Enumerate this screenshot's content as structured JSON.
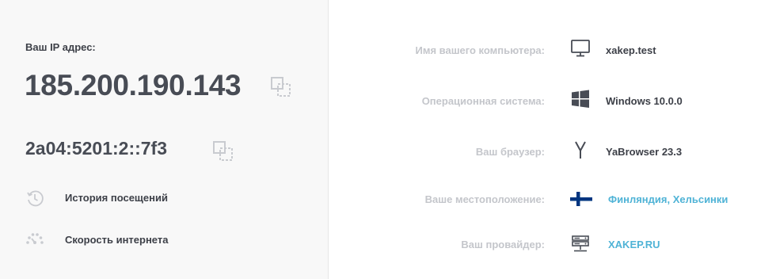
{
  "ip_block": {
    "label": "Ваш IP адрес:",
    "ipv4": "185.200.190.143",
    "ipv6": "2a04:5201:2::7f3"
  },
  "links": {
    "history": "История посещений",
    "speed": "Скорость интернета"
  },
  "info": [
    {
      "label": "Имя вашего компьютера:",
      "value": "xakep.test",
      "icon": "monitor-icon"
    },
    {
      "label": "Операционная система:",
      "value": "Windows 10.0.0",
      "icon": "windows-icon"
    },
    {
      "label": "Ваш браузер:",
      "value": "YaBrowser 23.3",
      "icon": "yandex-browser-icon"
    },
    {
      "label": "Ваше местоположение:",
      "value": "Финляндия, Хельсинки",
      "icon": "finland-flag-icon"
    },
    {
      "label": "Ваш провайдер:",
      "value": "XAKEP.RU",
      "icon": "server-icon"
    }
  ],
  "colors": {
    "text": "#3d4048",
    "muted_label": "#c4c6cb",
    "link": "#4fb3d6",
    "flag_blue": "#003580"
  }
}
